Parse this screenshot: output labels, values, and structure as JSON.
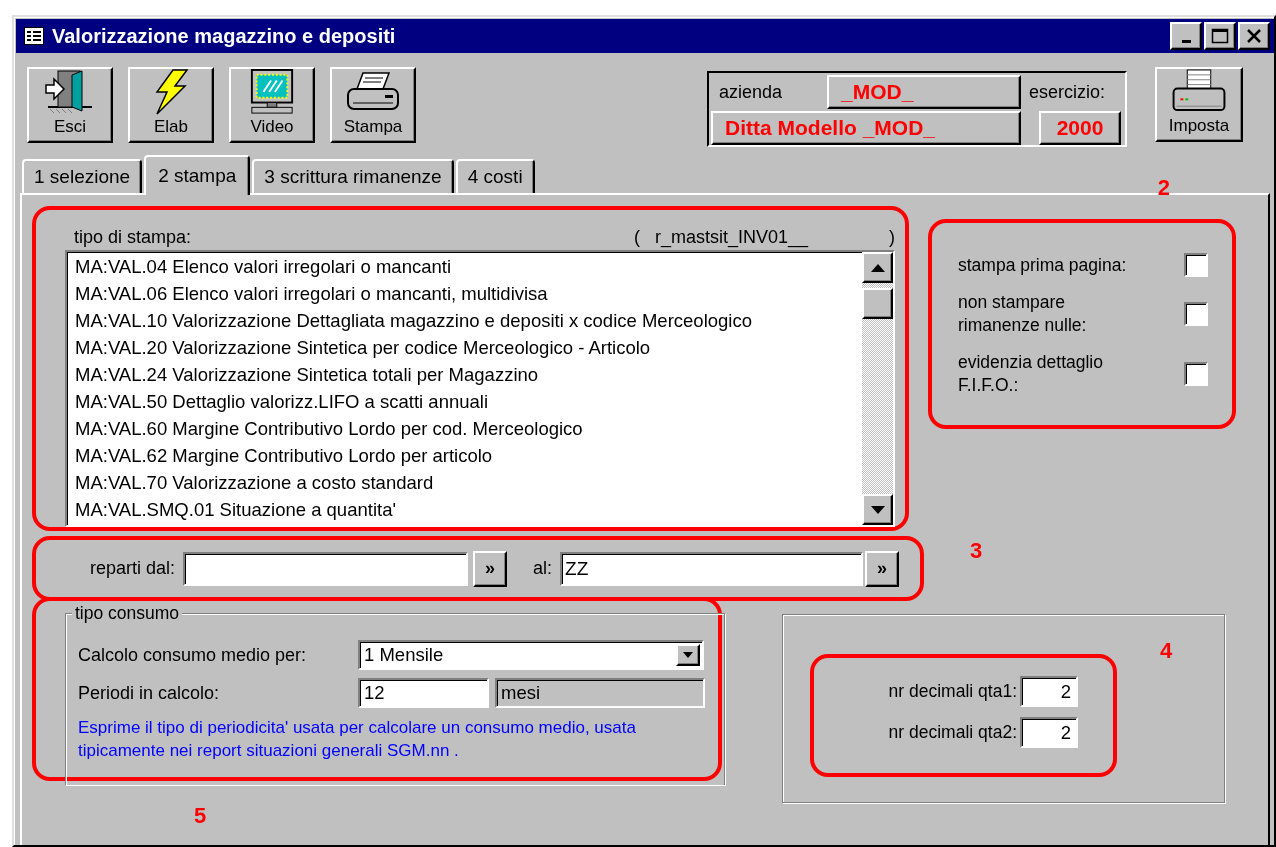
{
  "window": {
    "title": "Valorizzazione magazzino e depositi"
  },
  "toolbar": [
    {
      "label": "Esci",
      "kind": "exit"
    },
    {
      "label": "Elab",
      "kind": "bolt"
    },
    {
      "label": "Video",
      "kind": "monitor"
    },
    {
      "label": "Stampa",
      "kind": "printer"
    }
  ],
  "company": {
    "azienda_label": "azienda",
    "azienda_code": "_MOD_",
    "esercizio_label": "esercizio:",
    "company_name": "Ditta Modello _MOD_",
    "year": "2000"
  },
  "setup_button": {
    "label": "Imposta"
  },
  "tabs": [
    {
      "label": "1 selezione",
      "selected": false
    },
    {
      "label": "2 stampa",
      "selected": true
    },
    {
      "label": "3 scrittura rimanenze",
      "selected": false
    },
    {
      "label": "4 costi",
      "selected": false
    }
  ],
  "report_list": {
    "label": "tipo di stampa:",
    "report_code": "(   r_mastsit_INV01__",
    "closing": ")",
    "items": [
      {
        "text": "MA:VAL.04 Elenco valori irregolari o mancanti"
      },
      {
        "text": "MA:VAL.06 Elenco valori irregolari o mancanti, multidivisa"
      },
      {
        "text": "MA:VAL.10 Valorizzazione Dettagliata magazzino e depositi x codice Merceologico"
      },
      {
        "text": "MA:VAL.20 Valorizzazione Sintetica per codice Merceologico - Articolo"
      },
      {
        "text": "MA:VAL.24 Valorizzazione Sintetica totali per Magazzino"
      },
      {
        "text": "MA:VAL.50 Dettaglio valorizz.LIFO a scatti annuali"
      },
      {
        "text": "MA:VAL.60 Margine Contributivo Lordo per cod. Merceologico"
      },
      {
        "text": "MA:VAL.62 Margine Contributivo Lordo per articolo"
      },
      {
        "text": "MA:VAL.70 Valorizzazione a costo standard"
      },
      {
        "text": "MA:VAL.SMQ.01 Situazione a quantita'"
      }
    ]
  },
  "options": {
    "annotation": "2",
    "items": [
      {
        "label": "stampa prima pagina:",
        "checked": false
      },
      {
        "label": "non stampare\nrimanenze nulle:",
        "checked": false
      },
      {
        "label": "evidenzia dettaglio\nF.I.F.O.:",
        "checked": false
      }
    ]
  },
  "departments": {
    "annotation": "3",
    "from_label": "reparti dal:",
    "from_button": "»",
    "to_label": "al:",
    "to_value": "ZZ",
    "to_button": "»"
  },
  "consumption": {
    "annotation": "5",
    "title": "tipo consumo",
    "method_label": "Calcolo consumo medio per:",
    "method_value": "1 Mensile",
    "periods_label": "Periodi in calcolo:",
    "periods_value": "12",
    "periods_unit": "mesi",
    "note": "Esprime il tipo di periodicita' usata per calcolare un consumo medio, usata tipicamente nei report situazioni generali SGM.nn ."
  },
  "precision": {
    "annotation": "4",
    "fields": [
      {
        "label": "nr decimali qta1:",
        "value": "2"
      },
      {
        "label": "nr decimali qta2:",
        "value": "2"
      }
    ]
  }
}
